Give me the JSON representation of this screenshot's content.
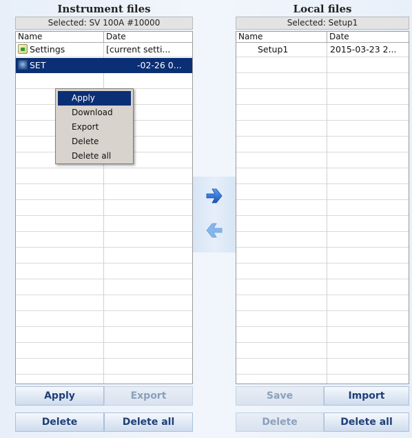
{
  "instrument": {
    "title": "Instrument files",
    "selected": "Selected: SV 100A #10000",
    "columns": [
      "Name",
      "Date"
    ],
    "rows": [
      {
        "name": "Settings",
        "date": "[current setti...",
        "icon": "settings-file-icon"
      },
      {
        "name": "SET",
        "date": "-02-26 0...",
        "icon": "setup-file-icon"
      }
    ],
    "buttons": {
      "apply": "Apply",
      "export": "Export",
      "delete": "Delete",
      "delete_all": "Delete all"
    }
  },
  "local": {
    "title": "Local files",
    "selected": "Selected: Setup1",
    "columns": [
      "Name",
      "Date"
    ],
    "rows": [
      {
        "name": "Setup1",
        "date": "2015-03-23 2..."
      }
    ],
    "buttons": {
      "save": "Save",
      "import": "Import",
      "delete": "Delete",
      "delete_all": "Delete all"
    }
  },
  "context_menu": {
    "items": [
      "Apply",
      "Download",
      "Export",
      "Delete",
      "Delete all"
    ],
    "highlighted": "Apply"
  },
  "transfer": {
    "right_icon": "arrow-right-icon",
    "left_icon": "arrow-left-icon"
  },
  "colors": {
    "selection": "#0b2f75",
    "button_text": "#1f3f78",
    "arrow_right": "#2a6ed6",
    "arrow_left": "#7faee6"
  }
}
